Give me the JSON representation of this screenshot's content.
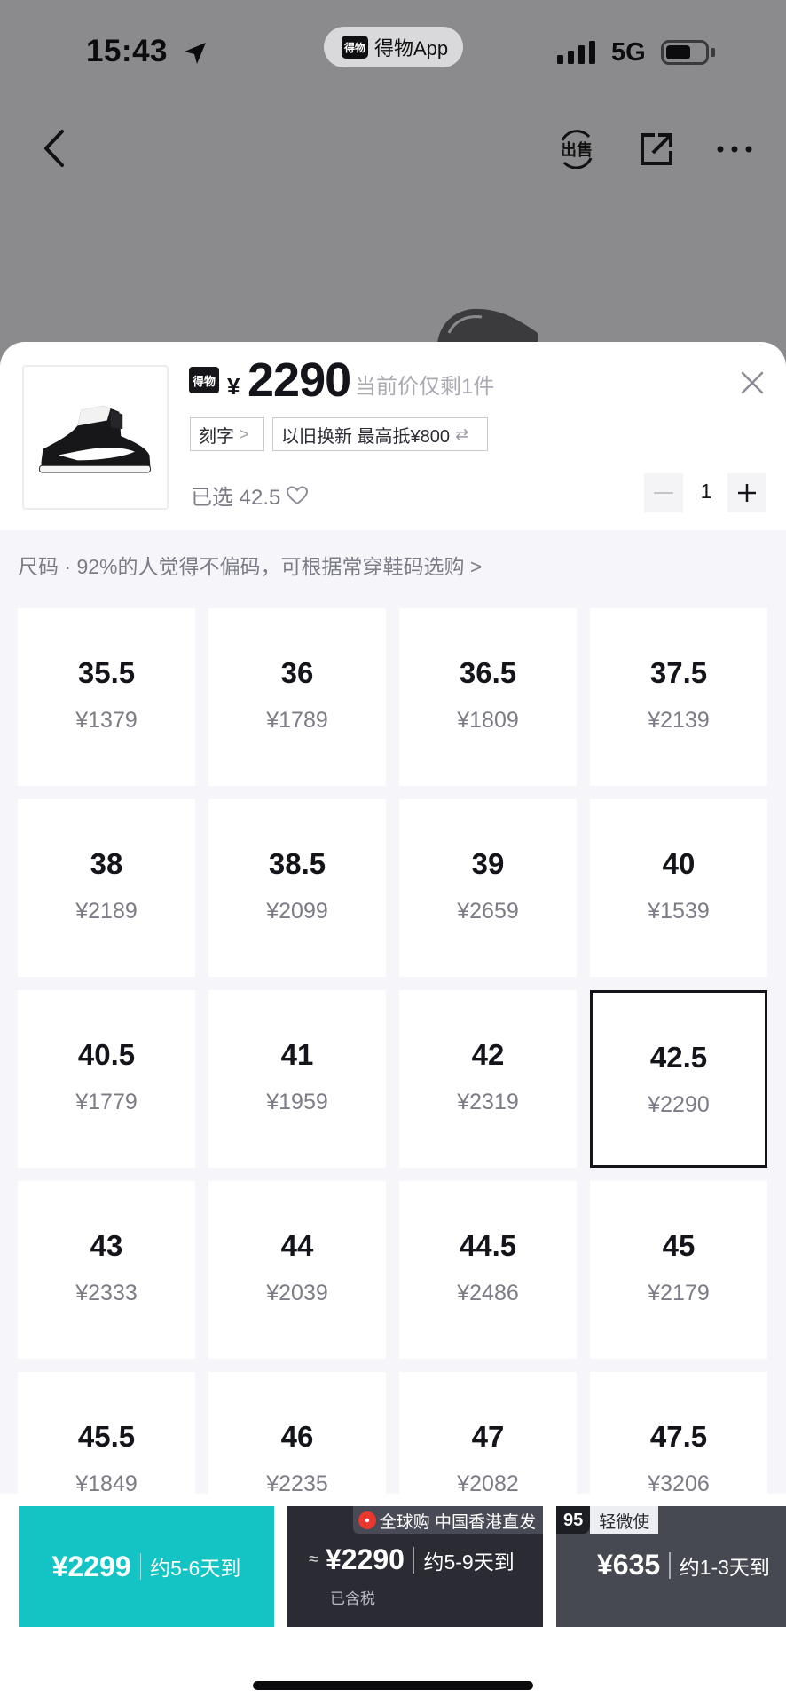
{
  "status_bar": {
    "time": "15:43",
    "app_name": "得物App",
    "app_logo_text": "得物",
    "network": "5G"
  },
  "nav": {
    "back_icon": "chevron-left-icon",
    "sell_icon": "sell-icon",
    "share_icon": "share-icon",
    "more_icon": "more-icon"
  },
  "product": {
    "brand_logo_text": "得物",
    "currency": "¥",
    "price": "2290",
    "price_note": "当前价仅剩1件",
    "tags": [
      {
        "label": "刻字",
        "suffix": ">"
      },
      {
        "label": "以旧换新 最高抵¥800",
        "suffix": "⇄"
      }
    ],
    "selected_label": "已选 42.5",
    "quantity": "1"
  },
  "size_selector": {
    "hint": "尺码 · 92%的人觉得不偏码，可根据常穿鞋码选购 >",
    "selected": "42.5",
    "sizes": [
      {
        "size": "35.5",
        "price": "¥1379"
      },
      {
        "size": "36",
        "price": "¥1789"
      },
      {
        "size": "36.5",
        "price": "¥1809"
      },
      {
        "size": "37.5",
        "price": "¥2139"
      },
      {
        "size": "38",
        "price": "¥2189"
      },
      {
        "size": "38.5",
        "price": "¥2099"
      },
      {
        "size": "39",
        "price": "¥2659"
      },
      {
        "size": "40",
        "price": "¥1539"
      },
      {
        "size": "40.5",
        "price": "¥1779"
      },
      {
        "size": "41",
        "price": "¥1959"
      },
      {
        "size": "42",
        "price": "¥2319"
      },
      {
        "size": "42.5",
        "price": "¥2290"
      },
      {
        "size": "43",
        "price": "¥2333"
      },
      {
        "size": "44",
        "price": "¥2039"
      },
      {
        "size": "44.5",
        "price": "¥2486"
      },
      {
        "size": "45",
        "price": "¥2179"
      },
      {
        "size": "45.5",
        "price": "¥1849"
      },
      {
        "size": "46",
        "price": "¥2235"
      },
      {
        "size": "47",
        "price": "¥2082"
      },
      {
        "size": "47.5",
        "price": "¥3206"
      }
    ]
  },
  "purchase_options": [
    {
      "price": "¥2299",
      "eta": "约5-6天到",
      "color": "#14c3c3"
    },
    {
      "approx": "≈",
      "price": "¥2290",
      "eta": "约5-9天到",
      "tax": "已含税",
      "badge": "全球购 中国香港直发",
      "color": "#2a2b33"
    },
    {
      "price": "¥635",
      "eta": "约1-3天到",
      "badge_score": "95",
      "badge": "轻微使",
      "color": "#474952"
    }
  ]
}
